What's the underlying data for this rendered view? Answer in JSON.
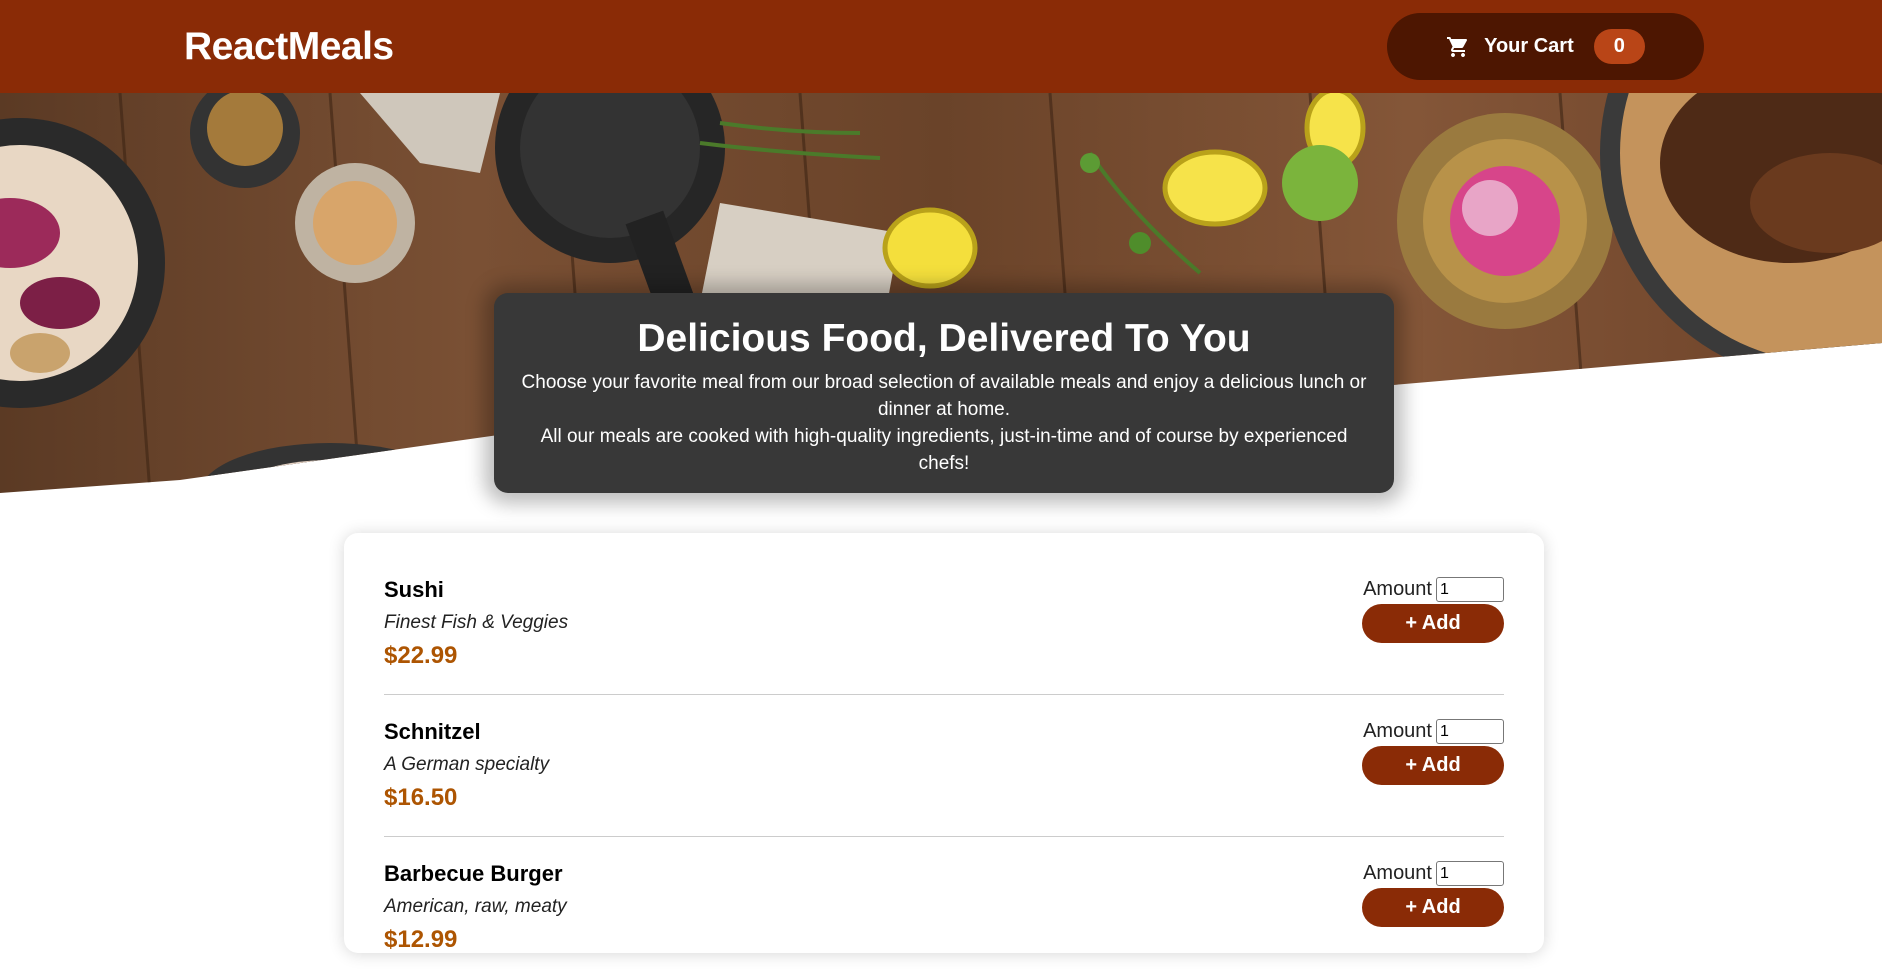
{
  "header": {
    "logo": "ReactMeals",
    "cart": {
      "label": "Your Cart",
      "count": "0",
      "icon": "cart-icon"
    }
  },
  "summary": {
    "title": "Delicious Food, Delivered To You",
    "paragraph1": "Choose your favorite meal from our broad selection of available meals and enjoy a delicious lunch or dinner at home.",
    "paragraph2": "All our meals are cooked with high-quality ingredients, just-in-time and of course by experienced chefs!"
  },
  "meals": [
    {
      "name": "Sushi",
      "description": "Finest Fish & Veggies",
      "price": "$22.99",
      "amount_label": "Amount",
      "amount_value": "1",
      "add_label": "+ Add"
    },
    {
      "name": "Schnitzel",
      "description": "A German specialty",
      "price": "$16.50",
      "amount_label": "Amount",
      "amount_value": "1",
      "add_label": "+ Add"
    },
    {
      "name": "Barbecue Burger",
      "description": "American, raw, meaty",
      "price": "$12.99",
      "amount_label": "Amount",
      "amount_value": "1",
      "add_label": "+ Add"
    }
  ],
  "colors": {
    "header_bg": "#8a2b06",
    "cart_bg": "#4d1601",
    "badge_bg": "#b94517",
    "summary_bg": "#383838",
    "price": "#ad5502"
  }
}
